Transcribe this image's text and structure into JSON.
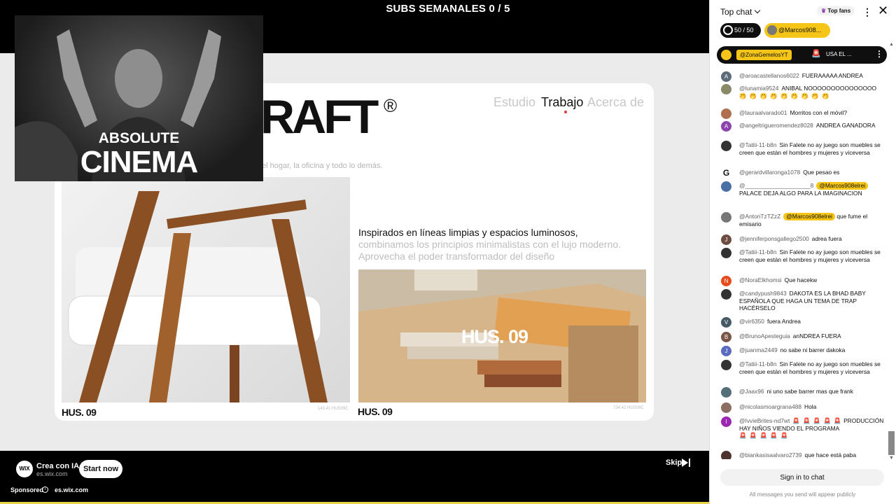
{
  "overlay": {
    "subs_header": "SUBS SEMANALES 0 / 5"
  },
  "ad_site": {
    "brand": "RAFT",
    "reg_mark": "®",
    "nav": [
      "Estudio",
      "Trabajo",
      "Acerca de"
    ],
    "tagline": "el hogar, la oficina y todo lo demás.",
    "headline_dark": "Inspirados en líneas limpias y espacios luminosos,",
    "headline_light": "combinamos los principios minimalistas con el lujo moderno. Aprovecha el poder transformador del diseño",
    "overlay_logo": "HUS. 09",
    "caption_left": "HUS. 09",
    "caption_right": "HUS. 09",
    "sku_left": "143.41 HUS09C",
    "sku_right": "734.42 HUS09C"
  },
  "pip": {
    "line1": "ABSOLUTE",
    "line2": "CINEMA"
  },
  "ad_bar": {
    "logo": "WIX",
    "title": "Crea con IA",
    "domain": "es.wix.com",
    "cta": "Start now",
    "sponsored": "Sponsored",
    "info": "i",
    "sponsored_domain": "es.wix.com",
    "skip": "Skip"
  },
  "chat": {
    "mode": "Top chat",
    "top_fans": "Top fans",
    "counter": "50 / 50",
    "featured_user": "@Marcos908...",
    "pinned_user": "@ZonaGemelosYT",
    "pinned_msg": "USA EL ...",
    "messages": [
      {
        "author": "@aroacastellanos6022",
        "text": "FUERAAAAA ANDREA",
        "initial": "A",
        "color": "#5c6b7a"
      },
      {
        "author": "@lunamia9524",
        "text": "ANIBAL NOOOOOOOOOOOOOOO",
        "initial": "",
        "color": "#8a8a6a",
        "emoji": "🤭 🤭 🤭 🤭 🤭 🤭 🤭 🤭 🤭"
      },
      {
        "author": "@lauraalvarado01",
        "text": "Morritos con el móvil?",
        "initial": "",
        "color": "#b07050"
      },
      {
        "author": "@angeltrigueromendez8028",
        "text": "ANDREA GANADORA",
        "initial": "A",
        "color": "#8e44ad"
      },
      {
        "author": "@Tatiii-11-b8n",
        "text": "Sin Falete no ay juego son muebles se creen que están el hombres y mujeres y viceversa",
        "initial": "",
        "color": "#333"
      },
      {
        "author": "@gerardvillaronga1078",
        "text": "Que pesao es",
        "initial": "G",
        "color": "#fff"
      },
      {
        "author": "@____________________8",
        "mention": "@Marcos908elrei",
        "text": "PALACE DEJA ALGO PARA LA IMAGINACION",
        "initial": "",
        "color": "#4a6fa5"
      },
      {
        "author": "@AntonTzTZzZ",
        "mention": "@Marcos908elrei",
        "text": "que fume el emisario",
        "initial": "",
        "color": "#777"
      },
      {
        "author": "@jenniferponsgallego2500",
        "text": "adrea fuera",
        "initial": "J",
        "color": "#6d4c41"
      },
      {
        "author": "@Tatiii-11-b8n",
        "text": "Sin Falete no ay juego son muebles se creen que están el hombres y mujeres y viceversa",
        "initial": "",
        "color": "#333"
      },
      {
        "author": "@NoraElkhomsi",
        "text": "Que hacekw",
        "initial": "N",
        "color": "#e64a19"
      },
      {
        "author": "@candypush9843",
        "text": "DAKOTA ES LA BHAD BABY ESPAÑOLA QUE HAGA UN TEMA DE TRAP HACÉRSELO",
        "initial": "",
        "color": "#333"
      },
      {
        "author": "@vir6350",
        "text": "fuera Andrea",
        "initial": "V",
        "color": "#455a64"
      },
      {
        "author": "@BrunoApesteguia",
        "text": "anNDREA FUERA",
        "initial": "B",
        "color": "#795548"
      },
      {
        "author": "@juanma2449",
        "text": "no sabe ni barrer dakoka",
        "initial": "J",
        "color": "#5c6bc0"
      },
      {
        "author": "@Tatiii-11-b8n",
        "text": "Sin Falete no ay juego son muebles se creen que están el hombres y mujeres y viceversa",
        "initial": "",
        "color": "#333"
      },
      {
        "author": "@Jaax96",
        "text": "ni uno sabe barrer mas que frank",
        "initial": "",
        "color": "#546e7a"
      },
      {
        "author": "@nicolasmoargrana488",
        "text": "Hola",
        "initial": "",
        "color": "#8d6e63"
      },
      {
        "author": "@IvvieBrites-nd7wt",
        "text": "PRODUCCIÓN HAY NIÑOS VIENDO EL PROGRAMA",
        "initial": "I",
        "color": "#9c27b0",
        "emoji_before": "🚨 🚨 🚨 🚨 🚨",
        "emoji_after": "🚨 🚨 🚨 🚨 🚨"
      },
      {
        "author": "@biankasisaalvaro2739",
        "text": "que hace está paba",
        "initial": "",
        "color": "#4e342e"
      }
    ],
    "sign_in": "Sign in to chat",
    "disclaimer": "All messages you send will appear publicly"
  },
  "colors": {
    "accent": "#f5c518",
    "progress": "#e8d44a"
  }
}
